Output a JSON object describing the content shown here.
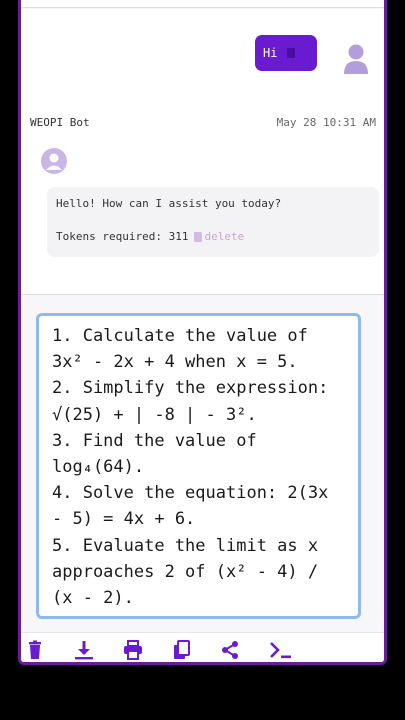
{
  "user_message": {
    "text": "Hi"
  },
  "bot": {
    "name": "WEOPI Bot",
    "timestamp": "May 28 10:31 AM",
    "message": "Hello! How can I assist you today?",
    "tokens_label": "Tokens required: 311",
    "delete_label": "delete"
  },
  "input": {
    "value": "1. Calculate the value of 3x² - 2x + 4 when x = 5.\n2. Simplify the expression: √(25) + | -8 | - 3².\n3. Find the value of log₄(64).\n4. Solve the equation: 2(3x - 5) = 4x + 6.\n5. Evaluate the limit as x approaches 2 of (x² - 4) / (x - 2)."
  },
  "toolbar": {
    "icons": [
      "trash-icon",
      "download-icon",
      "print-icon",
      "copy-icon",
      "share-icon",
      "terminal-icon"
    ]
  },
  "colors": {
    "accent": "#6a1bd1",
    "frame": "#6a1b9a",
    "input_border": "#90b9f0"
  }
}
